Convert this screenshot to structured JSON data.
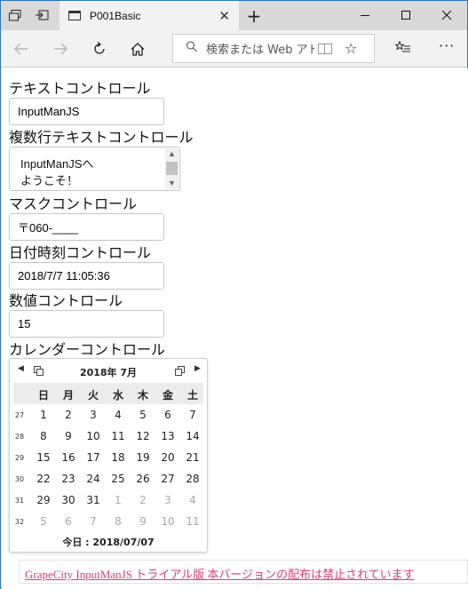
{
  "browser": {
    "tab_title": "P001Basic",
    "new_tab": "+",
    "address_placeholder": "検索または Web アドレス"
  },
  "labels": {
    "text": "テキストコントロール",
    "multiline": "複数行テキストコントロール",
    "mask": "マスクコントロール",
    "datetime": "日付時刻コントロール",
    "number": "数値コントロール",
    "calendar": "カレンダーコントロール"
  },
  "fields": {
    "text_value": "InputManJS",
    "multiline_line1": "InputManJSへ",
    "multiline_line2": "ようこそ！",
    "mask_value": "〒060-____",
    "datetime_value": "2018/7/7 11:05:36",
    "number_value": "15"
  },
  "calendar": {
    "month_title": "2018年 7月",
    "weekdays": [
      "日",
      "月",
      "火",
      "水",
      "木",
      "金",
      "土"
    ],
    "weeks": [
      {
        "week": "27",
        "days": [
          "1",
          "2",
          "3",
          "4",
          "5",
          "6",
          "7"
        ]
      },
      {
        "week": "28",
        "days": [
          "8",
          "9",
          "10",
          "11",
          "12",
          "13",
          "14"
        ]
      },
      {
        "week": "29",
        "days": [
          "15",
          "16",
          "17",
          "18",
          "19",
          "20",
          "21"
        ]
      },
      {
        "week": "30",
        "days": [
          "22",
          "23",
          "24",
          "25",
          "26",
          "27",
          "28"
        ]
      },
      {
        "week": "31",
        "days": [
          "29",
          "30",
          "31",
          "1",
          "2",
          "3",
          "4"
        ]
      },
      {
        "week": "32",
        "days": [
          "5",
          "6",
          "7",
          "8",
          "9",
          "10",
          "11"
        ]
      }
    ],
    "today_label": "今日 : 2018/07/07"
  },
  "banner": {
    "text": "GrapeCity InputManJS トライアル版 本バージョンの配布は禁止されています"
  }
}
